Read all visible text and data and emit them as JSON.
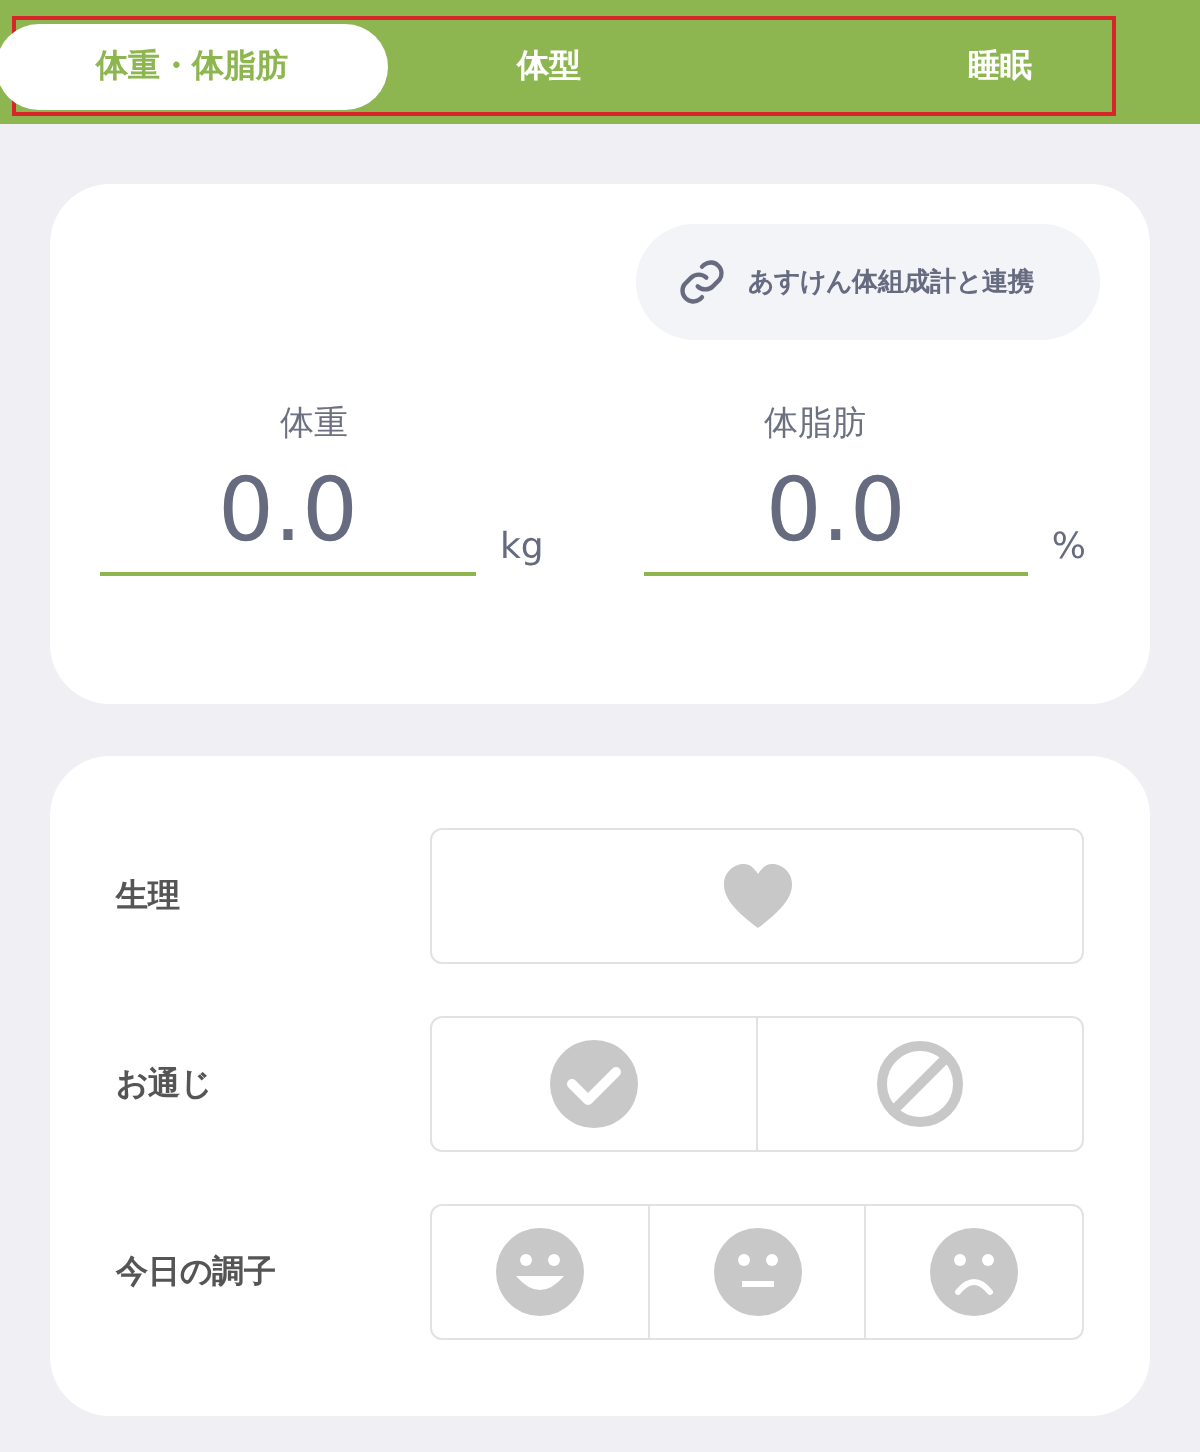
{
  "tabs": [
    {
      "label": "体重・体脂肪",
      "selected": true
    },
    {
      "label": "体型",
      "selected": false
    },
    {
      "label": "睡眠",
      "selected": false
    }
  ],
  "tabs_highlighted": true,
  "link_button": {
    "label": "あすけん体組成計と連携"
  },
  "metrics": [
    {
      "label": "体重",
      "value": "0.0",
      "unit": "kg"
    },
    {
      "label": "体脂肪",
      "value": "0.0",
      "unit": "%"
    }
  ],
  "conditions": [
    {
      "label": "生理",
      "options": [
        {
          "kind": "heart",
          "selected": false
        }
      ]
    },
    {
      "label": "お通じ",
      "options": [
        {
          "kind": "check",
          "selected": false
        },
        {
          "kind": "none",
          "selected": false
        }
      ]
    },
    {
      "label": "今日の調子",
      "options": [
        {
          "kind": "smile",
          "selected": false
        },
        {
          "kind": "neutral",
          "selected": false
        },
        {
          "kind": "frown",
          "selected": false
        }
      ]
    }
  ]
}
